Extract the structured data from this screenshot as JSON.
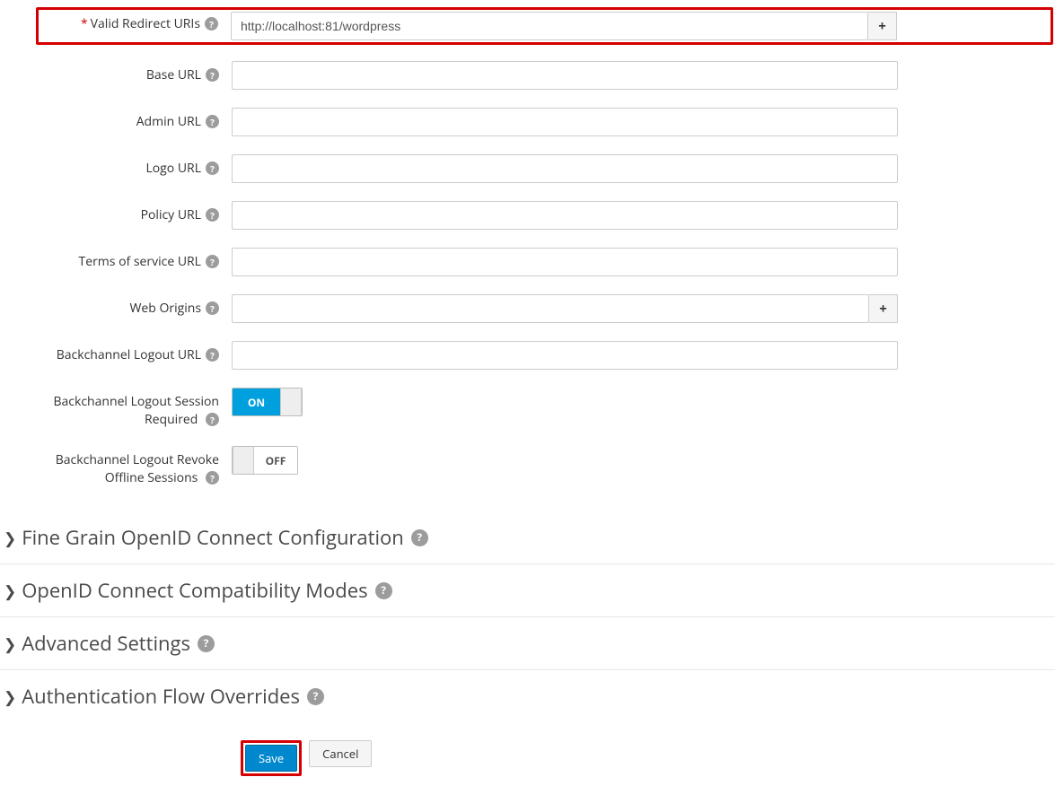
{
  "fields": {
    "validRedirect": {
      "label": "Valid Redirect URIs",
      "required": true,
      "value": "http://localhost:81/wordpress",
      "add": true
    },
    "baseUrl": {
      "label": "Base URL",
      "value": ""
    },
    "adminUrl": {
      "label": "Admin URL",
      "value": ""
    },
    "logoUrl": {
      "label": "Logo URL",
      "value": ""
    },
    "policyUrl": {
      "label": "Policy URL",
      "value": ""
    },
    "tosUrl": {
      "label": "Terms of service URL",
      "value": ""
    },
    "webOrigins": {
      "label": "Web Origins",
      "value": "",
      "add": true
    },
    "backLogoutUrl": {
      "label": "Backchannel Logout URL",
      "value": ""
    },
    "backLogoutSessionReq": {
      "label_l1": "Backchannel Logout Session",
      "label_l2": "Required",
      "state": "ON"
    },
    "backLogoutRevoke": {
      "label_l1": "Backchannel Logout Revoke",
      "label_l2": "Offline Sessions",
      "state": "OFF"
    }
  },
  "sections": {
    "fineGrain": "Fine Grain OpenID Connect Configuration",
    "compat": "OpenID Connect Compatibility Modes",
    "advanced": "Advanced Settings",
    "authFlow": "Authentication Flow Overrides"
  },
  "buttons": {
    "save": "Save",
    "cancel": "Cancel"
  },
  "toggleLabels": {
    "on": "ON",
    "off": "OFF"
  },
  "icons": {
    "help": "?",
    "add": "+",
    "chev": "❯"
  }
}
